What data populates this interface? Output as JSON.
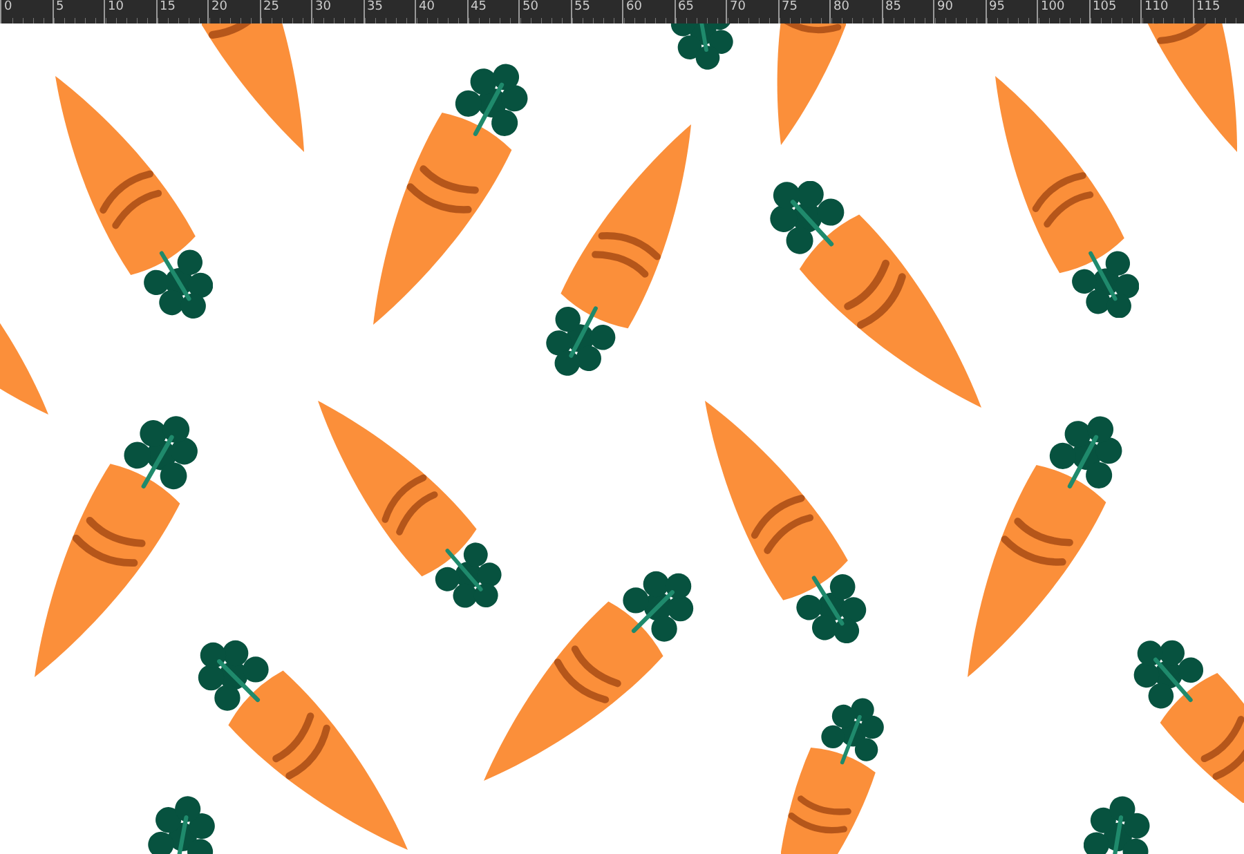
{
  "ruler": {
    "labels": [
      "0",
      "5",
      "10",
      "15",
      "20",
      "25",
      "30",
      "35",
      "40",
      "45",
      "50",
      "55",
      "60",
      "65",
      "70",
      "75",
      "80",
      "85",
      "90",
      "95",
      "100",
      "105",
      "110",
      "115"
    ]
  }
}
